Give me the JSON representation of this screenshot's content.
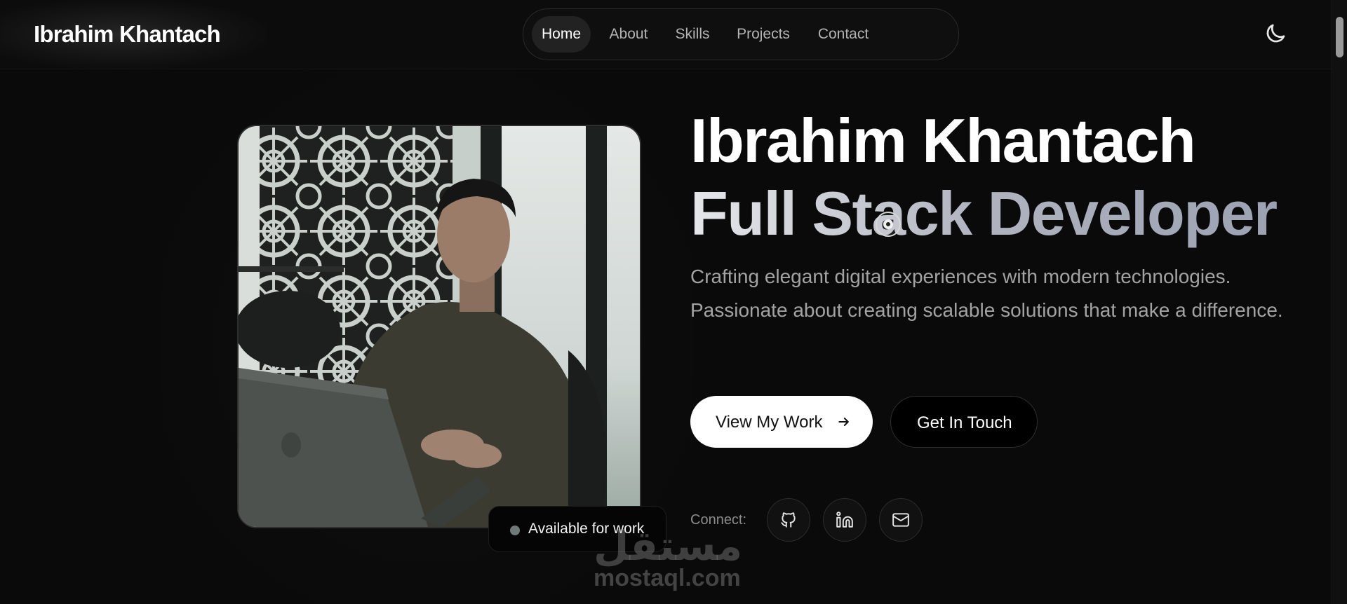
{
  "header": {
    "brand": "Ibrahim Khantach",
    "nav": [
      {
        "label": "Home",
        "active": true
      },
      {
        "label": "About",
        "active": false
      },
      {
        "label": "Skills",
        "active": false
      },
      {
        "label": "Projects",
        "active": false
      },
      {
        "label": "Contact",
        "active": false
      }
    ],
    "theme_toggle_icon": "moon-icon"
  },
  "hero": {
    "name": "Ibrahim Khantach",
    "role": "Full Stack Developer",
    "tagline": "Crafting elegant digital experiences with modern technologies. Passionate about creating scalable solutions that make a difference.",
    "primary_button": "View My Work",
    "secondary_button": "Get In Touch",
    "connect_label": "Connect:",
    "socials": [
      "github-icon",
      "linkedin-icon",
      "mail-icon"
    ],
    "status_badge": "Available for work"
  },
  "watermark": {
    "arabic": "مستقل",
    "latin": "mostaql.com"
  },
  "colors": {
    "background": "#0a0a0a",
    "text_primary": "#ffffff",
    "text_muted": "#a3a3a3",
    "badge_dot": "#6f7a78",
    "button_primary_bg": "#ffffff"
  }
}
